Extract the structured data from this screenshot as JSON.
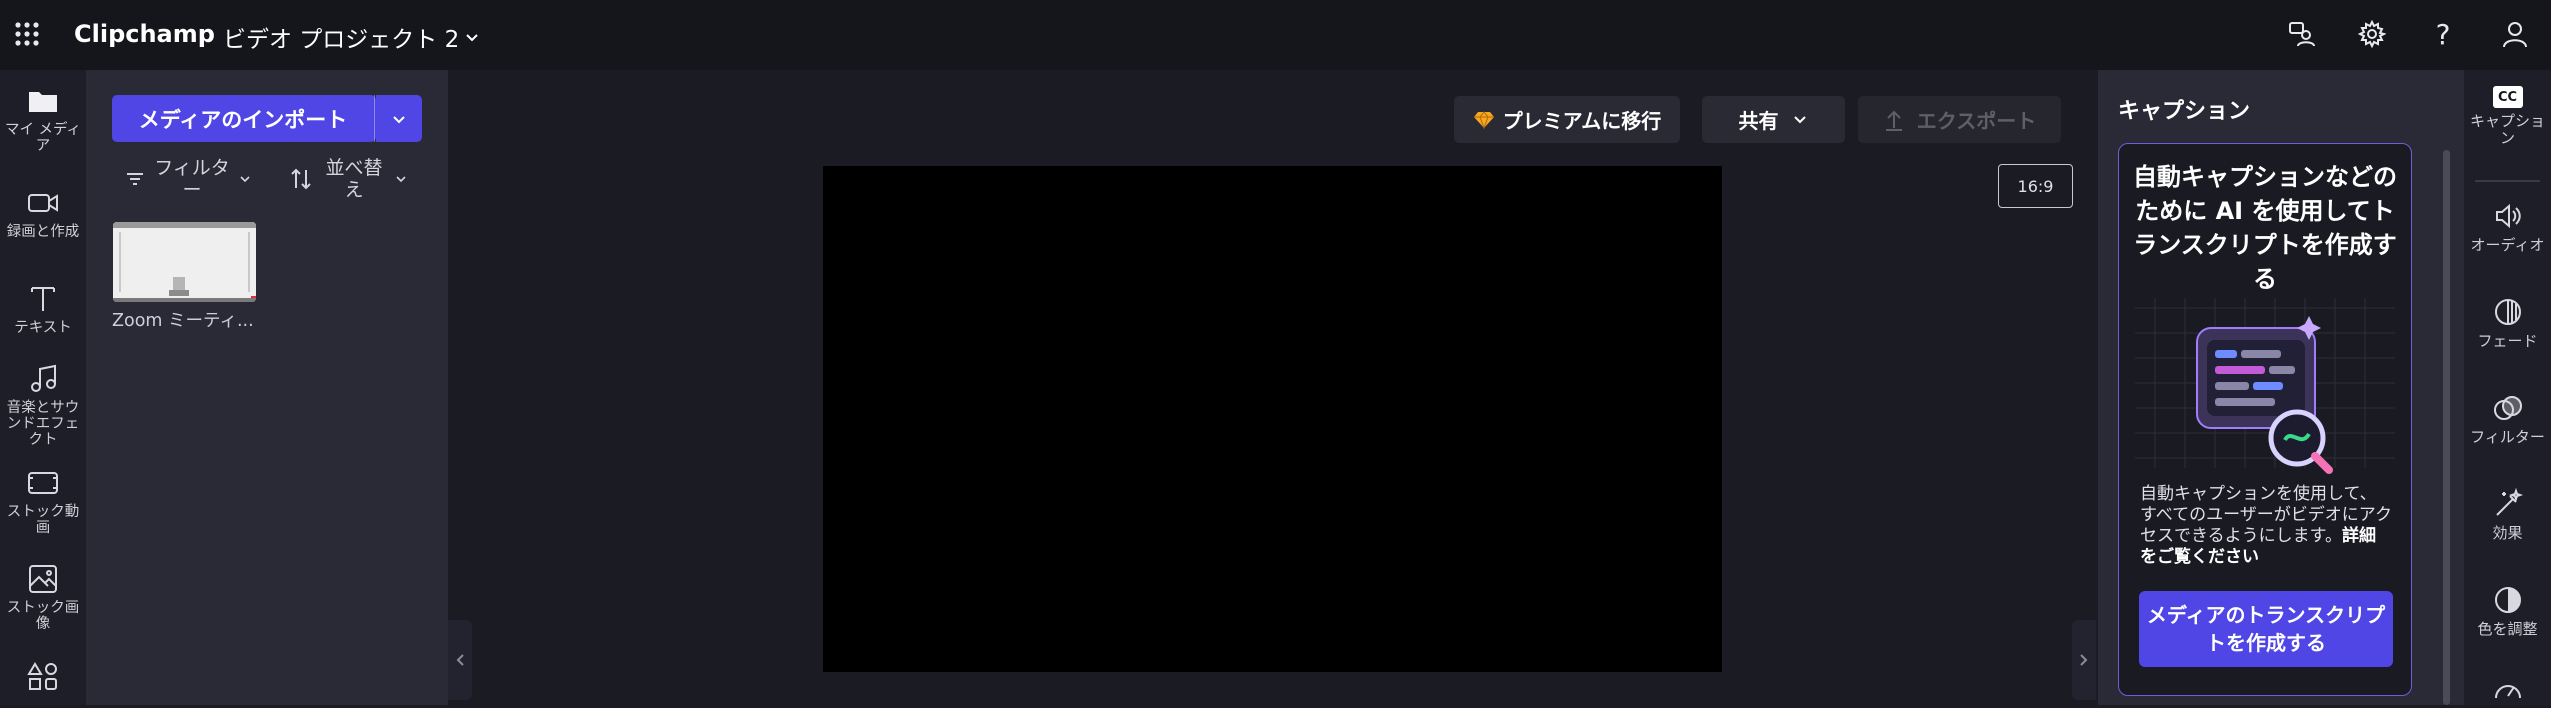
{
  "app": {
    "name": "Clipchamp",
    "project_title": "ビデオ プロジェクト 2"
  },
  "top_icons": [
    "share-people-icon",
    "gear-icon",
    "help-icon",
    "account-icon"
  ],
  "left_rail": [
    {
      "label": "マイ メディア",
      "icon": "folder-icon"
    },
    {
      "label": "録画と作成",
      "icon": "camera-icon"
    },
    {
      "label": "テキスト",
      "icon": "text-icon"
    },
    {
      "label": "音楽とサウンドエフェクト",
      "icon": "music-icon"
    },
    {
      "label": "ストック動画",
      "icon": "film-icon"
    },
    {
      "label": "ストック画像",
      "icon": "image-icon"
    },
    {
      "label": "",
      "icon": "shapes-icon"
    }
  ],
  "media": {
    "import_label": "メディアのインポート",
    "filter_label": "フィルター",
    "sort_label": "並べ替え",
    "items": [
      {
        "label": "Zoom ミーティ..."
      }
    ]
  },
  "toolbar": {
    "premium_label": "プレミアムに移行",
    "share_label": "共有",
    "export_label": "エクスポート",
    "aspect_ratio": "16:9"
  },
  "captions": {
    "title": "キャプション",
    "heading": "自動キャプションなどのために AI を使用してトランスクリプトを作成する",
    "description": "自動キャプションを使用して、すべてのユーザーがビデオにアクセスできるようにします。",
    "details_link": "詳細をご覧ください",
    "create_button": "メディアのトランスクリプトを作成する"
  },
  "right_rail": [
    {
      "label": "キャプション",
      "icon": "cc-icon"
    },
    {
      "label": "オーディオ",
      "icon": "speaker-icon"
    },
    {
      "label": "フェード",
      "icon": "fade-icon"
    },
    {
      "label": "フィルター",
      "icon": "filter-circles-icon"
    },
    {
      "label": "効果",
      "icon": "magic-wand-icon"
    },
    {
      "label": "色を調整",
      "icon": "contrast-icon"
    },
    {
      "label": "",
      "icon": "speed-icon"
    }
  ],
  "colors": {
    "accent": "#4f46e5",
    "background": "#1b1b24",
    "panel": "#292a36",
    "rail": "#1e1e28"
  }
}
